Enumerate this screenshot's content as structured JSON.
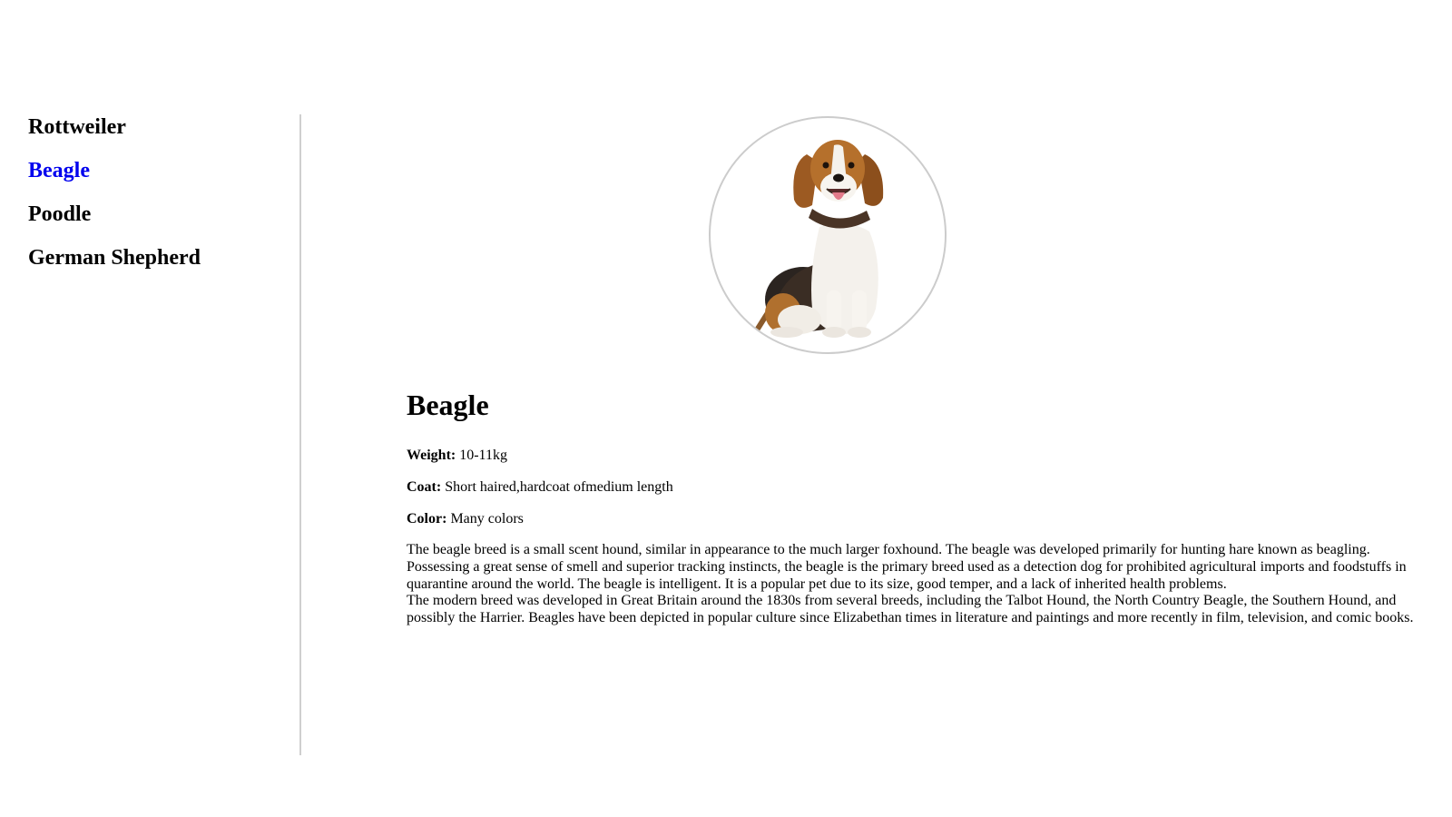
{
  "sidebar": {
    "items": [
      {
        "label": "Rottweiler",
        "active": false
      },
      {
        "label": "Beagle",
        "active": true
      },
      {
        "label": "Poodle",
        "active": false
      },
      {
        "label": "German Shepherd",
        "active": false
      }
    ]
  },
  "colors": {
    "active_link": "#0000ee",
    "divider": "#cfcfcf",
    "avatar_border": "#cccccc"
  },
  "breed": {
    "image_icon": "beagle-photo",
    "name": "Beagle",
    "weight_label": "Weight:",
    "weight_value": "10-11kg",
    "coat_label": "Coat:",
    "coat_value": "Short haired,hardcoat ofmedium length",
    "color_label": "Color:",
    "color_value": "Many colors",
    "description_1": "The beagle breed is a small scent hound, similar in appearance to the much larger foxhound. The beagle was developed primarily for hunting hare known as beagling. Possessing a great sense of smell and superior tracking instincts, the beagle is the primary breed used as a detection dog for prohibited agricultural imports and foodstuffs in quarantine around the world. The beagle is intelligent. It is a popular pet due to its size, good temper, and a lack of inherited health problems.",
    "description_2": "The modern breed was developed in Great Britain around the 1830s from several breeds, including the Talbot Hound, the North Country Beagle, the Southern Hound, and possibly the Harrier. Beagles have been depicted in popular culture since Elizabethan times in literature and paintings and more recently in film, television, and comic books."
  }
}
